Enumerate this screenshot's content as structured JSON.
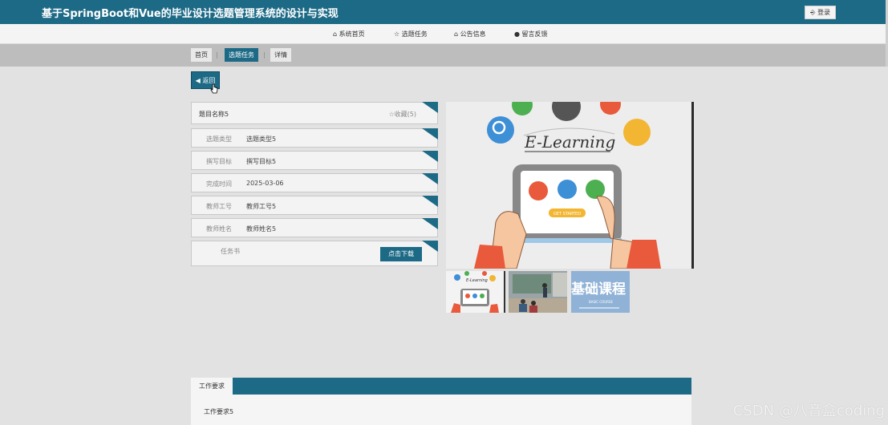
{
  "header": {
    "site_title": "基于SpringBoot和Vue的毕业设计选题管理系统的设计与实现",
    "login_label": "⎆ 登录"
  },
  "nav": {
    "items": [
      {
        "icon": "home-icon",
        "label": "⌂ 系统首页"
      },
      {
        "icon": "star-icon",
        "label": "☆ 选题任务"
      },
      {
        "icon": "lock-icon",
        "label": "⌂ 公告信息"
      },
      {
        "icon": "info-icon",
        "label": "● 留言反馈"
      }
    ]
  },
  "breadcrumb": {
    "items": [
      "首页",
      "选题任务",
      "详情"
    ],
    "separator": "|"
  },
  "back_label": "◀ 返回",
  "detail": {
    "title": "题目名称5",
    "favorite_label": "☆收藏(5)",
    "fields": [
      {
        "label": "选题类型",
        "value": "选题类型5"
      },
      {
        "label": "撰写目标",
        "value": "撰写目标5"
      },
      {
        "label": "完成时间",
        "value": "2025-03-06"
      },
      {
        "label": "教师工号",
        "value": "教师工号5"
      },
      {
        "label": "教师姓名",
        "value": "教师姓名5"
      }
    ],
    "file_label": "任务书",
    "download_label": "点击下载"
  },
  "gallery": {
    "main_caption": "E-Learning",
    "main_button": "GET STARTED",
    "thumb1_caption": "E-Learning",
    "thumb3_caption": "基础课程",
    "thumb3_sub": "BASIC COURSE"
  },
  "tabs": {
    "active_label": "工作要求",
    "content": "工作要求5"
  },
  "watermark": "CSDN @八音盒coding",
  "colors": {
    "primary": "#1d6a86",
    "background": "#e2e2e2"
  }
}
